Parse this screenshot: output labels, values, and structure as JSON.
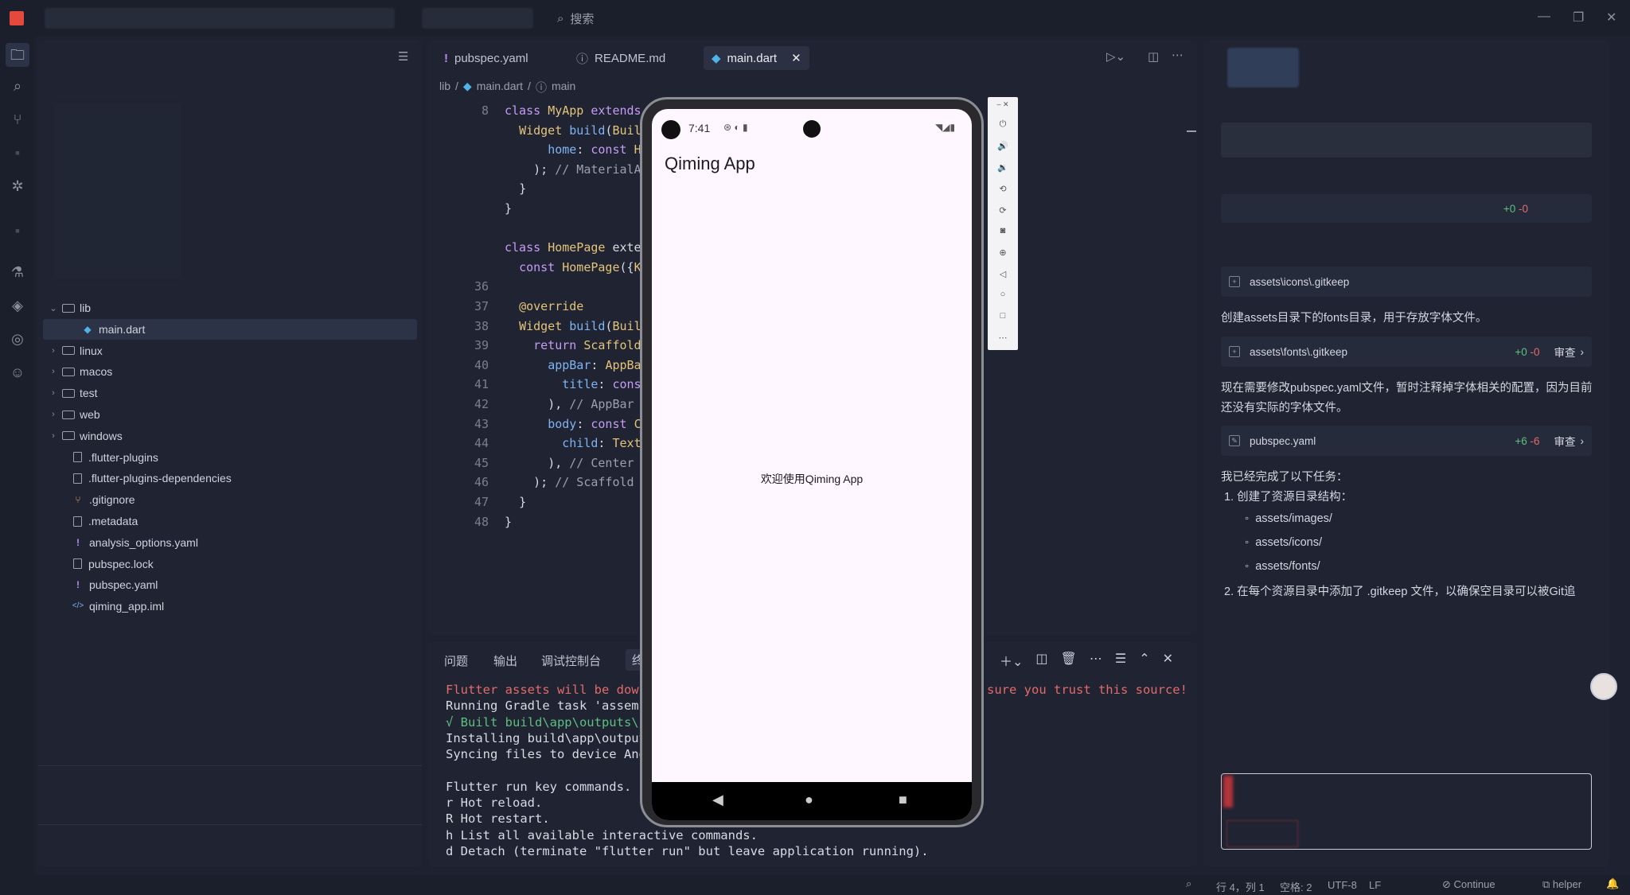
{
  "titlebar": {
    "search_placeholder": "搜索"
  },
  "sidebar": {
    "tree": [
      {
        "label": "lib",
        "kind": "folder",
        "expanded": true
      },
      {
        "label": "main.dart",
        "kind": "dart",
        "selected": true
      },
      {
        "label": "linux",
        "kind": "folder"
      },
      {
        "label": "macos",
        "kind": "folder"
      },
      {
        "label": "test",
        "kind": "folder"
      },
      {
        "label": "web",
        "kind": "folder"
      },
      {
        "label": "windows",
        "kind": "folder"
      },
      {
        "label": ".flutter-plugins",
        "kind": "file"
      },
      {
        "label": ".flutter-plugins-dependencies",
        "kind": "file"
      },
      {
        "label": ".gitignore",
        "kind": "git"
      },
      {
        "label": ".metadata",
        "kind": "file"
      },
      {
        "label": "analysis_options.yaml",
        "kind": "yaml"
      },
      {
        "label": "pubspec.lock",
        "kind": "file"
      },
      {
        "label": "pubspec.yaml",
        "kind": "yaml"
      },
      {
        "label": "qiming_app.iml",
        "kind": "xml"
      }
    ]
  },
  "editor": {
    "tabs": [
      {
        "label": "pubspec.yaml",
        "icon": "!"
      },
      {
        "label": "README.md",
        "icon": "?"
      },
      {
        "label": "main.dart",
        "icon": "dart",
        "active": true
      }
    ],
    "breadcrumb": [
      "lib",
      "main.dart",
      "main"
    ],
    "lines": [
      {
        "n": "8",
        "code": "class MyApp extends St"
      },
      {
        "n": "",
        "code": "  Widget build(BuildC"
      },
      {
        "n": "",
        "code": "      home: const Hom"
      },
      {
        "n": "",
        "code": "    ); // MaterialApp"
      },
      {
        "n": "",
        "code": "  }"
      },
      {
        "n": "",
        "code": "}"
      },
      {
        "n": "",
        "code": ""
      },
      {
        "n": "",
        "code": "class HomePage extend"
      },
      {
        "n": "",
        "code": "  const HomePage({Key"
      },
      {
        "n": "36",
        "code": ""
      },
      {
        "n": "37",
        "code": "  @override"
      },
      {
        "n": "38",
        "code": "  Widget build(BuildC"
      },
      {
        "n": "39",
        "code": "    return Scaffold("
      },
      {
        "n": "40",
        "code": "      appBar: AppBar("
      },
      {
        "n": "41",
        "code": "        title: const "
      },
      {
        "n": "42",
        "code": "      ), // AppBar"
      },
      {
        "n": "43",
        "code": "      body: const Cen"
      },
      {
        "n": "44",
        "code": "        child: Text('"
      },
      {
        "n": "45",
        "code": "      ), // Center"
      },
      {
        "n": "46",
        "code": "    ); // Scaffold"
      },
      {
        "n": "47",
        "code": "  }"
      },
      {
        "n": "48",
        "code": "}"
      }
    ]
  },
  "panel": {
    "tabs": [
      "问题",
      "输出",
      "调试控制台",
      "终端"
    ],
    "terminal": [
      {
        "text": "Flutter assets will be down",
        "color": "#e26b6b"
      },
      {
        "text": "Running Gradle task 'assemb",
        "color": "#d8dbe3"
      },
      {
        "text": "√ Built build\\app\\outputs\\f",
        "color": "#5fbf7f"
      },
      {
        "text": "Installing build\\app\\output",
        "color": "#d8dbe3"
      },
      {
        "text": "Syncing files to device And",
        "color": "#d8dbe3"
      },
      {
        "text": "",
        "color": "#d8dbe3"
      },
      {
        "text": "Flutter run key commands.",
        "color": "#d8dbe3"
      },
      {
        "text": "r Hot reload.",
        "color": "#d8dbe3"
      },
      {
        "text": "R Hot restart.",
        "color": "#d8dbe3"
      },
      {
        "text": "h List all available interactive commands.",
        "color": "#d8dbe3"
      },
      {
        "text": "d Detach (terminate \"flutter run\" but leave application running).",
        "color": "#d8dbe3"
      }
    ],
    "terminal_tail": "sure you trust this source!"
  },
  "phone": {
    "time": "7:41",
    "app_title": "Qiming App",
    "body_text": "欢迎使用Qiming App"
  },
  "chat": {
    "card1_diff_add": "+0",
    "card1_diff_del": "-0",
    "file_icons": "assets\\icons\\.gitkeep",
    "msg_fonts": "创建assets目录下的fonts目录，用于存放字体文件。",
    "file_fonts": "assets\\fonts\\.gitkeep",
    "fonts_add": "+0",
    "fonts_del": "-0",
    "review": "审查",
    "msg_pubspec": "现在需要修改pubspec.yaml文件，暂时注释掉字体相关的配置，因为目前还没有实际的字体文件。",
    "file_pubspec": "pubspec.yaml",
    "pubspec_add": "+6",
    "pubspec_del": "-6",
    "done_title": "我已经完成了以下任务：",
    "step1": "1. 创建了资源目录结构：",
    "sub": [
      "assets/images/",
      "assets/icons/",
      "assets/fonts/"
    ],
    "step2": "2. 在每个资源目录中添加了 .gitkeep 文件，以确保空目录可以被Git追"
  },
  "statusbar": {
    "position": "行 4，列 1",
    "spaces": "空格: 2",
    "encoding": "UTF-8",
    "eol": "LF",
    "continue": "Continue",
    "helper": "helper"
  }
}
